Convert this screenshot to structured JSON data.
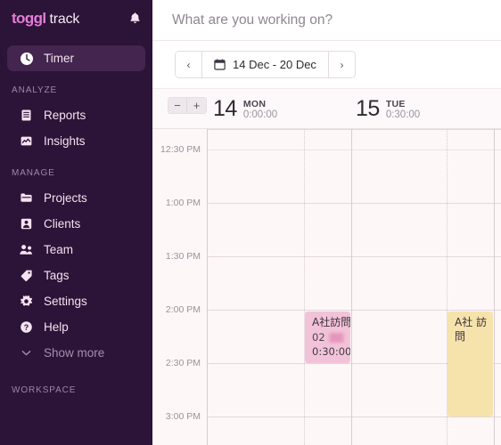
{
  "sidebar": {
    "brand": {
      "primary": "toggl",
      "secondary": "track",
      "accent_color": "#e57cd8"
    },
    "notification_icon": "bell-icon",
    "items": [
      {
        "label": "Timer",
        "icon": "clock-icon",
        "active": true
      },
      {
        "label": "Reports",
        "icon": "report-icon",
        "active": false
      },
      {
        "label": "Insights",
        "icon": "insights-icon",
        "active": false
      },
      {
        "label": "Projects",
        "icon": "folder-icon",
        "active": false
      },
      {
        "label": "Clients",
        "icon": "person-icon",
        "active": false
      },
      {
        "label": "Team",
        "icon": "people-icon",
        "active": false
      },
      {
        "label": "Tags",
        "icon": "tag-icon",
        "active": false
      },
      {
        "label": "Settings",
        "icon": "gear-icon",
        "active": false
      },
      {
        "label": "Help",
        "icon": "help-icon",
        "active": false
      },
      {
        "label": "Show more",
        "icon": "chevron-down-icon",
        "active": false
      }
    ],
    "sections": {
      "analyze": "ANALYZE",
      "manage": "MANAGE",
      "workspace": "WORKSPACE"
    },
    "background_color": "#2c1338"
  },
  "topbar": {
    "placeholder": "What are you working on?",
    "value": ""
  },
  "datebar": {
    "prev_label": "‹",
    "next_label": "›",
    "calendar_icon": "calendar-icon",
    "range_label": "14 Dec - 20 Dec"
  },
  "zoom_controls": {
    "minus_label": "−",
    "plus_label": "+"
  },
  "days": [
    {
      "num": "14",
      "dow": "MON",
      "total": "0:00:00"
    },
    {
      "num": "15",
      "dow": "TUE",
      "total": "0:30:00"
    }
  ],
  "time_axis": {
    "labels": [
      "12:30 PM",
      "1:00 PM",
      "1:30 PM",
      "2:00 PM",
      "2:30 PM",
      "3:00 PM"
    ]
  },
  "events": [
    {
      "title": "A社訪問",
      "code": "02",
      "redacted": true,
      "duration": "0:30:00",
      "color": "#f2c3d8",
      "day": "MON",
      "start": "2:00 PM",
      "end": "2:30 PM"
    },
    {
      "title": "A社 訪問",
      "color": "#f6e2ab",
      "day": "TUE",
      "start": "2:00 PM",
      "end": "3:00 PM"
    }
  ]
}
